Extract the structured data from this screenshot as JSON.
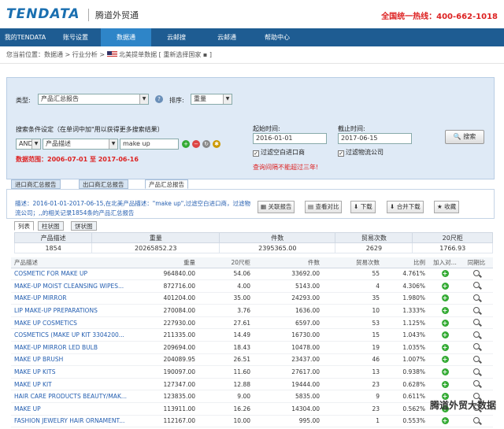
{
  "header": {
    "logo": "TENDATA",
    "subtitle": "腾道外贸通",
    "hotline": "全国统一热线：400-662-1018"
  },
  "nav": [
    {
      "label": "我的TENDATA"
    },
    {
      "label": "账号设置"
    },
    {
      "label": "数据通"
    },
    {
      "label": "云邮搜"
    },
    {
      "label": "云邮通"
    },
    {
      "label": "帮助中心"
    }
  ],
  "breadcrumb": {
    "prefix": "您当前位置：数据通 > 行业分析 >",
    "country": "北美提单数据 [ 重新选择国家 ▪ ]"
  },
  "query": {
    "type_label": "类型:",
    "type_value": "产品汇总报告",
    "sort_label": "排序:",
    "sort_value": "重量",
    "cond_label": "搜索条件设定（在单词中加\"用以获得更多搜索结果）",
    "logic": "AND",
    "field": "产品描述",
    "keyword": "make up",
    "range": "数据范围：2006-07-01 至 2017-06-16",
    "start_label": "起始时间:",
    "start_value": "2016-01-01",
    "end_label": "截止时间:",
    "end_value": "2017-06-15",
    "filter_empty": "过滤空白进口商",
    "filter_logistics": "过滤物流公司",
    "warning": "查询间隔不能超过三年!",
    "search_btn": "搜索"
  },
  "tabs": [
    "进口商汇总报告",
    "出口商汇总报告",
    "产品汇总报告"
  ],
  "desc": "描述：2016-01-01-2017-06-15,在北美产品描述：\"make up\",过滤空白进口商，过滤物流公司；,,的相关记录1854条的产品汇总报告",
  "actions": [
    "关联报告",
    "查看对比",
    "下载",
    "合并下载",
    "收藏"
  ],
  "view_tabs": [
    "列表",
    "柱状图",
    "饼状图"
  ],
  "summary": {
    "headers": [
      "产品描述",
      "重量",
      "件数",
      "贸易次数",
      "20尺柜"
    ],
    "values": [
      "1854",
      "20265852.23",
      "2395365.00",
      "2629",
      "1766.93"
    ]
  },
  "table": {
    "headers": [
      "产品描述",
      "重量",
      "20尺柜",
      "件数",
      "贸易次数",
      "比例",
      "加入对...",
      "同期比"
    ],
    "rows": [
      [
        "COSMETIC FOR MAKE UP",
        "964840.00",
        "54.06",
        "33692.00",
        "55",
        "4.761%"
      ],
      [
        "MAKE-UP MOIST CLEANSING WIPES...",
        "872716.00",
        "4.00",
        "5143.00",
        "4",
        "4.306%"
      ],
      [
        "MAKE-UP MIRROR",
        "401204.00",
        "35.00",
        "24293.00",
        "35",
        "1.980%"
      ],
      [
        "LIP MAKE-UP PREPARATIONS",
        "270084.00",
        "3.76",
        "1636.00",
        "10",
        "1.333%"
      ],
      [
        "MAKE UP COSMETICS",
        "227930.00",
        "27.61",
        "6597.00",
        "53",
        "1.125%"
      ],
      [
        "COSMETICS (MAKE UP KIT 3304200...",
        "211335.00",
        "14.49",
        "16730.00",
        "15",
        "1.043%"
      ],
      [
        "MAKE-UP MIRROR LED BULB",
        "209694.00",
        "18.43",
        "10478.00",
        "19",
        "1.035%"
      ],
      [
        "MAKE UP BRUSH",
        "204089.95",
        "26.51",
        "23437.00",
        "46",
        "1.007%"
      ],
      [
        "MAKE UP KITS",
        "190097.00",
        "11.60",
        "27617.00",
        "13",
        "0.938%"
      ],
      [
        "MAKE UP KIT",
        "127347.00",
        "12.88",
        "19444.00",
        "23",
        "0.628%"
      ],
      [
        "HAIR CARE PRODUCTS BEAUTY/MAK...",
        "123835.00",
        "9.00",
        "5835.00",
        "9",
        "0.611%"
      ],
      [
        "MAKE UP",
        "113911.00",
        "16.26",
        "14304.00",
        "23",
        "0.562%"
      ],
      [
        "FASHION JEWELRY HAIR ORNAMENT...",
        "112167.00",
        "10.00",
        "995.00",
        "1",
        "0.553%"
      ]
    ]
  },
  "watermark": "腾道外贸大数据",
  "colors": {
    "nav": "#1e5c92",
    "nav_active": "#2e85c8",
    "accent": "#d22",
    "link": "#245eb0"
  }
}
